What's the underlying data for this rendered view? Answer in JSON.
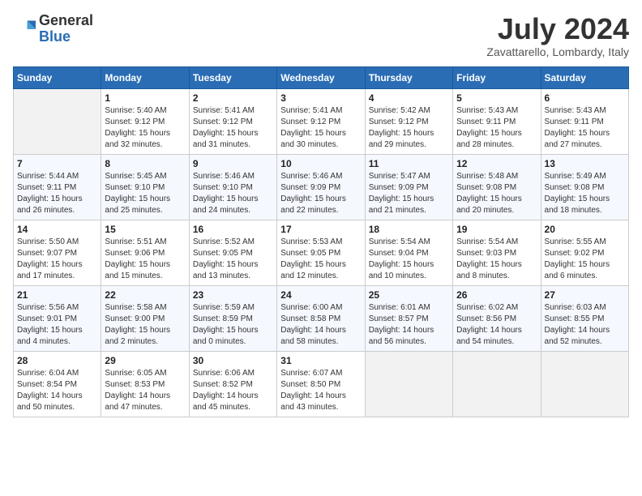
{
  "header": {
    "logo_line1": "General",
    "logo_line2": "Blue",
    "month_title": "July 2024",
    "subtitle": "Zavattarello, Lombardy, Italy"
  },
  "weekdays": [
    "Sunday",
    "Monday",
    "Tuesday",
    "Wednesday",
    "Thursday",
    "Friday",
    "Saturday"
  ],
  "weeks": [
    [
      {
        "day": "",
        "info": ""
      },
      {
        "day": "1",
        "info": "Sunrise: 5:40 AM\nSunset: 9:12 PM\nDaylight: 15 hours\nand 32 minutes."
      },
      {
        "day": "2",
        "info": "Sunrise: 5:41 AM\nSunset: 9:12 PM\nDaylight: 15 hours\nand 31 minutes."
      },
      {
        "day": "3",
        "info": "Sunrise: 5:41 AM\nSunset: 9:12 PM\nDaylight: 15 hours\nand 30 minutes."
      },
      {
        "day": "4",
        "info": "Sunrise: 5:42 AM\nSunset: 9:12 PM\nDaylight: 15 hours\nand 29 minutes."
      },
      {
        "day": "5",
        "info": "Sunrise: 5:43 AM\nSunset: 9:11 PM\nDaylight: 15 hours\nand 28 minutes."
      },
      {
        "day": "6",
        "info": "Sunrise: 5:43 AM\nSunset: 9:11 PM\nDaylight: 15 hours\nand 27 minutes."
      }
    ],
    [
      {
        "day": "7",
        "info": "Sunrise: 5:44 AM\nSunset: 9:11 PM\nDaylight: 15 hours\nand 26 minutes."
      },
      {
        "day": "8",
        "info": "Sunrise: 5:45 AM\nSunset: 9:10 PM\nDaylight: 15 hours\nand 25 minutes."
      },
      {
        "day": "9",
        "info": "Sunrise: 5:46 AM\nSunset: 9:10 PM\nDaylight: 15 hours\nand 24 minutes."
      },
      {
        "day": "10",
        "info": "Sunrise: 5:46 AM\nSunset: 9:09 PM\nDaylight: 15 hours\nand 22 minutes."
      },
      {
        "day": "11",
        "info": "Sunrise: 5:47 AM\nSunset: 9:09 PM\nDaylight: 15 hours\nand 21 minutes."
      },
      {
        "day": "12",
        "info": "Sunrise: 5:48 AM\nSunset: 9:08 PM\nDaylight: 15 hours\nand 20 minutes."
      },
      {
        "day": "13",
        "info": "Sunrise: 5:49 AM\nSunset: 9:08 PM\nDaylight: 15 hours\nand 18 minutes."
      }
    ],
    [
      {
        "day": "14",
        "info": "Sunrise: 5:50 AM\nSunset: 9:07 PM\nDaylight: 15 hours\nand 17 minutes."
      },
      {
        "day": "15",
        "info": "Sunrise: 5:51 AM\nSunset: 9:06 PM\nDaylight: 15 hours\nand 15 minutes."
      },
      {
        "day": "16",
        "info": "Sunrise: 5:52 AM\nSunset: 9:05 PM\nDaylight: 15 hours\nand 13 minutes."
      },
      {
        "day": "17",
        "info": "Sunrise: 5:53 AM\nSunset: 9:05 PM\nDaylight: 15 hours\nand 12 minutes."
      },
      {
        "day": "18",
        "info": "Sunrise: 5:54 AM\nSunset: 9:04 PM\nDaylight: 15 hours\nand 10 minutes."
      },
      {
        "day": "19",
        "info": "Sunrise: 5:54 AM\nSunset: 9:03 PM\nDaylight: 15 hours\nand 8 minutes."
      },
      {
        "day": "20",
        "info": "Sunrise: 5:55 AM\nSunset: 9:02 PM\nDaylight: 15 hours\nand 6 minutes."
      }
    ],
    [
      {
        "day": "21",
        "info": "Sunrise: 5:56 AM\nSunset: 9:01 PM\nDaylight: 15 hours\nand 4 minutes."
      },
      {
        "day": "22",
        "info": "Sunrise: 5:58 AM\nSunset: 9:00 PM\nDaylight: 15 hours\nand 2 minutes."
      },
      {
        "day": "23",
        "info": "Sunrise: 5:59 AM\nSunset: 8:59 PM\nDaylight: 15 hours\nand 0 minutes."
      },
      {
        "day": "24",
        "info": "Sunrise: 6:00 AM\nSunset: 8:58 PM\nDaylight: 14 hours\nand 58 minutes."
      },
      {
        "day": "25",
        "info": "Sunrise: 6:01 AM\nSunset: 8:57 PM\nDaylight: 14 hours\nand 56 minutes."
      },
      {
        "day": "26",
        "info": "Sunrise: 6:02 AM\nSunset: 8:56 PM\nDaylight: 14 hours\nand 54 minutes."
      },
      {
        "day": "27",
        "info": "Sunrise: 6:03 AM\nSunset: 8:55 PM\nDaylight: 14 hours\nand 52 minutes."
      }
    ],
    [
      {
        "day": "28",
        "info": "Sunrise: 6:04 AM\nSunset: 8:54 PM\nDaylight: 14 hours\nand 50 minutes."
      },
      {
        "day": "29",
        "info": "Sunrise: 6:05 AM\nSunset: 8:53 PM\nDaylight: 14 hours\nand 47 minutes."
      },
      {
        "day": "30",
        "info": "Sunrise: 6:06 AM\nSunset: 8:52 PM\nDaylight: 14 hours\nand 45 minutes."
      },
      {
        "day": "31",
        "info": "Sunrise: 6:07 AM\nSunset: 8:50 PM\nDaylight: 14 hours\nand 43 minutes."
      },
      {
        "day": "",
        "info": ""
      },
      {
        "day": "",
        "info": ""
      },
      {
        "day": "",
        "info": ""
      }
    ]
  ]
}
